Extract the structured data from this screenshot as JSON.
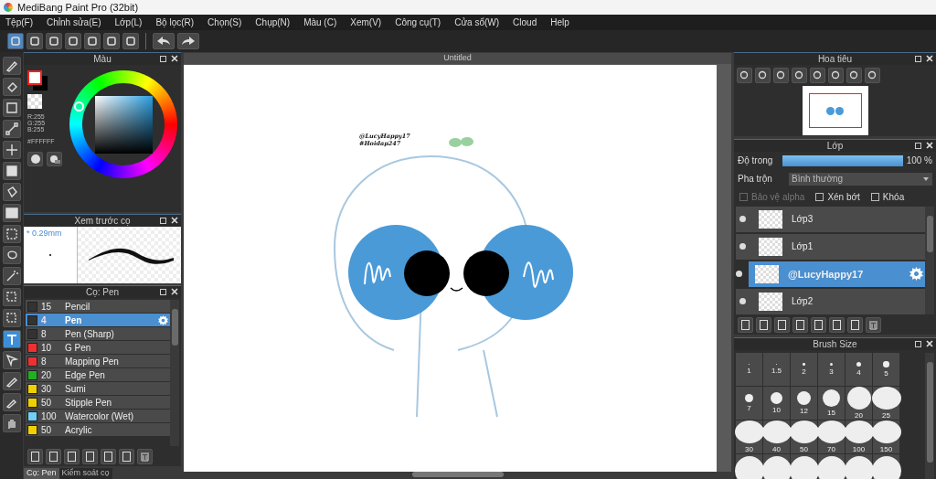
{
  "window": {
    "title": "MediBang Paint Pro (32bit)"
  },
  "menu": [
    "Tệp(F)",
    "Chỉnh sửa(E)",
    "Lớp(L)",
    "Bộ lọc(R)",
    "Chọn(S)",
    "Chụp(N)",
    "Màu (C)",
    "Xem(V)",
    "Công cụ(T)",
    "Cửa sổ(W)",
    "Cloud",
    "Help"
  ],
  "toolbar": [
    {
      "selected": true
    },
    {
      "selected": false
    },
    {
      "selected": false
    },
    {
      "selected": false
    },
    {
      "selected": false
    },
    {
      "selected": false
    },
    {
      "selected": false
    }
  ],
  "tools": [
    {
      "selected": false
    },
    {
      "selected": false
    },
    {
      "selected": false
    },
    {
      "selected": false
    },
    {
      "selected": false
    },
    {
      "selected": false
    },
    {
      "selected": false
    },
    {
      "selected": false
    },
    {
      "selected": false
    },
    {
      "selected": false
    },
    {
      "selected": false
    },
    {
      "selected": false
    },
    {
      "selected": false
    },
    {
      "selected": true
    },
    {
      "selected": false
    },
    {
      "selected": false
    },
    {
      "selected": false
    },
    {
      "selected": false
    }
  ],
  "color_panel": {
    "title": "Màu",
    "r": "R:255",
    "g": "G:255",
    "b": "B:255",
    "hex": "#FFFFFF"
  },
  "brush_preview": {
    "title": "Xem trước cọ",
    "size": "* 0.29mm"
  },
  "brushes": {
    "title": "Cọ: Pen",
    "items": [
      {
        "size": "15",
        "name": "Pencil",
        "color": "#333333",
        "selected": false
      },
      {
        "size": "4",
        "name": "Pen",
        "color": "#333333",
        "selected": true
      },
      {
        "size": "8",
        "name": "Pen (Sharp)",
        "color": "#333333",
        "selected": false
      },
      {
        "size": "10",
        "name": "G Pen",
        "color": "#f03030",
        "selected": false
      },
      {
        "size": "8",
        "name": "Mapping Pen",
        "color": "#f03030",
        "selected": false
      },
      {
        "size": "20",
        "name": "Edge Pen",
        "color": "#20b020",
        "selected": false
      },
      {
        "size": "30",
        "name": "Sumi",
        "color": "#f0d000",
        "selected": false
      },
      {
        "size": "50",
        "name": "Stipple Pen",
        "color": "#f0d000",
        "selected": false
      },
      {
        "size": "100",
        "name": "Watercolor (Wet)",
        "color": "#70d0f8",
        "selected": false
      },
      {
        "size": "50",
        "name": "Acrylic",
        "color": "#f0d000",
        "selected": false
      }
    ]
  },
  "bottom_tabs": [
    {
      "label": "Cọ: Pen",
      "selected": true
    },
    {
      "label": "Kiểm soát cọ",
      "selected": false
    }
  ],
  "canvas": {
    "tab": "Untitled",
    "texts": [
      "@LucyHappy17",
      "#Hoidap247"
    ]
  },
  "navigator": {
    "title": "Hoa tiêu"
  },
  "layers": {
    "title": "Lớp",
    "opacity_label": "Độ trong",
    "opacity": {
      "level": 1
    },
    "opacity_reading": "100 %",
    "blend_label": "Pha trộn",
    "blend_value": "Bình thường",
    "options": [
      {
        "label": "Bảo vệ alpha",
        "checked": false,
        "disabled": true
      },
      {
        "label": "Xén bớt",
        "checked": false,
        "disabled": false
      },
      {
        "label": "Khóa",
        "checked": false,
        "disabled": false
      }
    ],
    "items": [
      {
        "name": "Lớp3",
        "selected": false
      },
      {
        "name": "Lớp1",
        "selected": false
      },
      {
        "name": "@LucyHappy17",
        "selected": true
      },
      {
        "name": "Lớp2",
        "selected": false
      }
    ]
  },
  "brush_size": {
    "title": "Brush Size",
    "sizes": [
      "1",
      "1.5",
      "2",
      "3",
      "4",
      "5",
      "7",
      "10",
      "12",
      "15",
      "20",
      "25",
      "30",
      "40",
      "50",
      "70",
      "100",
      "150"
    ]
  }
}
